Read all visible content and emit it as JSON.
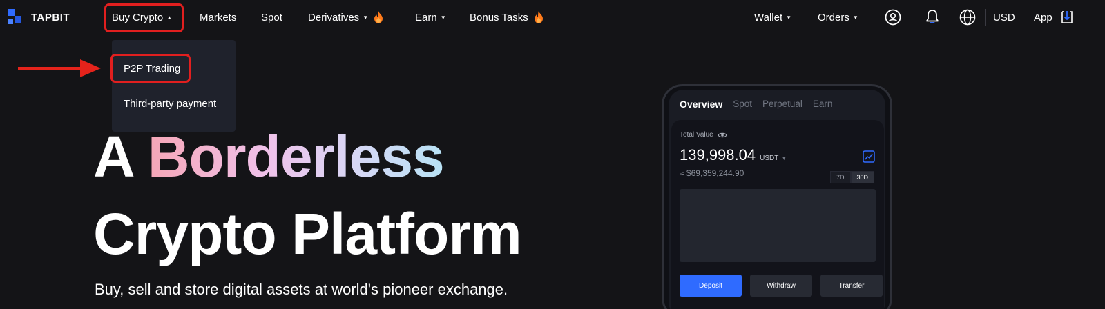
{
  "brand": {
    "name": "TAPBIT"
  },
  "nav": {
    "buy_crypto": "Buy Crypto",
    "markets": "Markets",
    "spot": "Spot",
    "derivatives": "Derivatives",
    "earn": "Earn",
    "bonus_tasks": "Bonus Tasks",
    "wallet": "Wallet",
    "orders": "Orders",
    "currency": "USD",
    "app": "App"
  },
  "dropdown": {
    "items": [
      {
        "label": "P2P Trading"
      },
      {
        "label": "Third-party payment"
      }
    ]
  },
  "hero": {
    "line1_plain": "A ",
    "line1_gradient": "Borderless",
    "line2": "Crypto Platform",
    "subtitle": "Buy, sell and store digital assets at world's pioneer exchange."
  },
  "phone": {
    "tabs": [
      "Overview",
      "Spot",
      "Perpetual",
      "Earn"
    ],
    "total_value_label": "Total Value",
    "total_value": "139,998.04",
    "unit": "USDT",
    "fiat_value": "≈ $69,359,244.90",
    "ranges": [
      "7D",
      "30D"
    ],
    "actions": [
      "Deposit",
      "Withdraw",
      "Transfer"
    ]
  },
  "colors": {
    "accent_blue": "#2f6bff",
    "highlight_red": "#e11f1f",
    "flame_orange": "#ff7a1a"
  }
}
